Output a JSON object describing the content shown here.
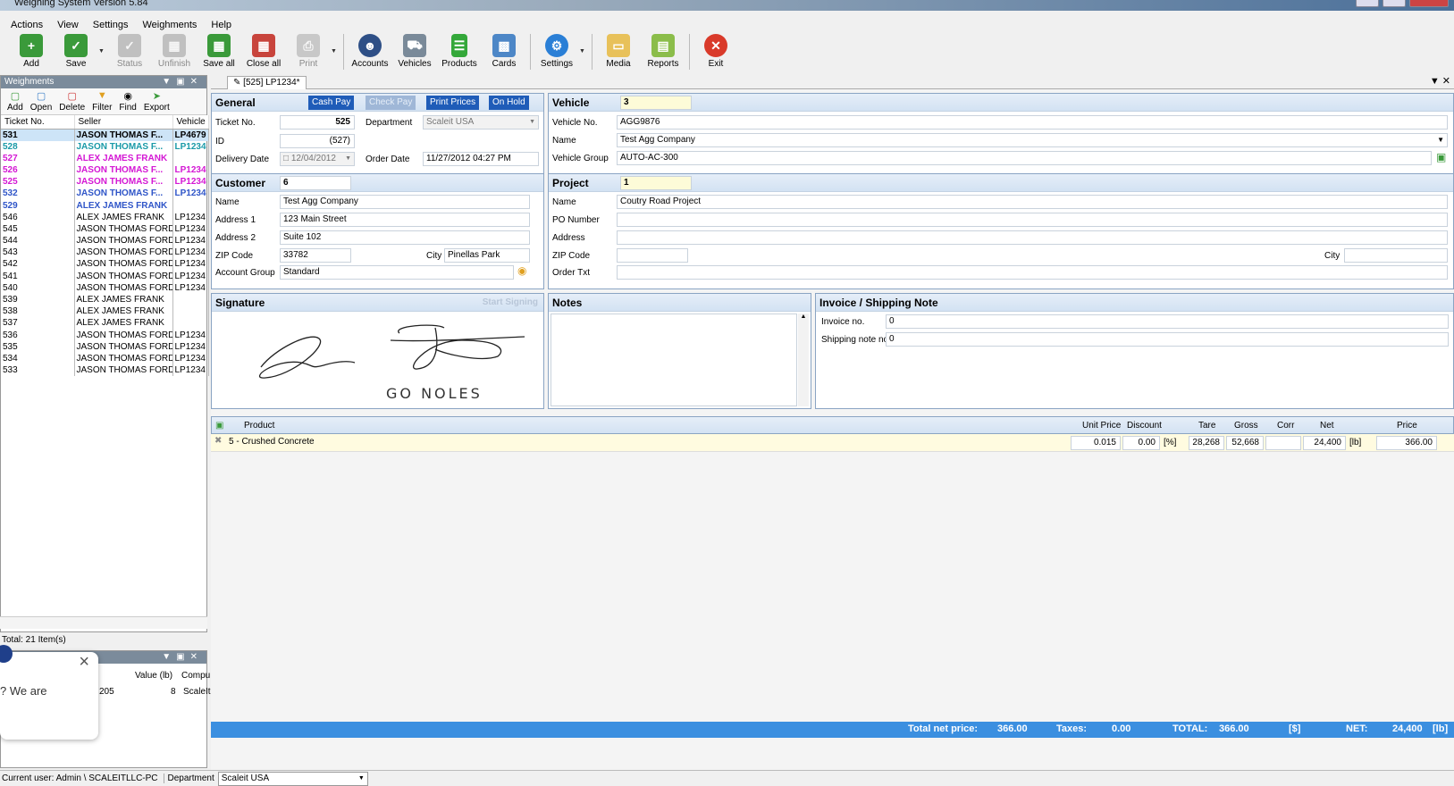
{
  "window": {
    "title": "Weighing System Version 5.84"
  },
  "menu": [
    "Actions",
    "View",
    "Settings",
    "Weighments",
    "Help"
  ],
  "toolbar": [
    {
      "label": "Add",
      "icon": "add-grid-icon",
      "enabled": true
    },
    {
      "label": "Save",
      "icon": "save-grid-icon",
      "enabled": true
    },
    {
      "label": "Status",
      "icon": "status-check-icon",
      "enabled": false
    },
    {
      "label": "Unfinish",
      "icon": "unfinish-grid-icon",
      "enabled": false
    },
    {
      "label": "Save all",
      "icon": "save-all-icon",
      "enabled": true
    },
    {
      "label": "Close all",
      "icon": "close-all-icon",
      "enabled": true
    },
    {
      "label": "Print",
      "icon": "printer-icon",
      "enabled": false
    },
    {
      "label": "Accounts",
      "icon": "accounts-icon",
      "enabled": true
    },
    {
      "label": "Vehicles",
      "icon": "vehicles-icon",
      "enabled": true
    },
    {
      "label": "Products",
      "icon": "products-icon",
      "enabled": true
    },
    {
      "label": "Cards",
      "icon": "cards-icon",
      "enabled": true
    },
    {
      "label": "Settings",
      "icon": "settings-gear-icon",
      "enabled": true
    },
    {
      "label": "Media",
      "icon": "media-folder-icon",
      "enabled": true
    },
    {
      "label": "Reports",
      "icon": "reports-icon",
      "enabled": true
    },
    {
      "label": "Exit",
      "icon": "exit-icon",
      "enabled": true
    }
  ],
  "weighments": {
    "title": "Weighments",
    "tools": [
      "Add",
      "Open",
      "Delete",
      "Filter",
      "Find",
      "Export"
    ],
    "columns": [
      "Ticket No.",
      "Seller",
      "Vehicle"
    ],
    "rows": [
      {
        "ticket": "531",
        "seller": "JASON THOMAS F...",
        "vehicle": "LP4679",
        "style": "sel"
      },
      {
        "ticket": "528",
        "seller": "JASON THOMAS F...",
        "vehicle": "LP1234",
        "style": "teal"
      },
      {
        "ticket": "527",
        "seller": "ALEX JAMES FRANK",
        "vehicle": "",
        "style": "mag"
      },
      {
        "ticket": "526",
        "seller": "JASON THOMAS F...",
        "vehicle": "LP1234",
        "style": "mag"
      },
      {
        "ticket": "525",
        "seller": "JASON THOMAS F...",
        "vehicle": "LP1234",
        "style": "mag"
      },
      {
        "ticket": "532",
        "seller": "JASON THOMAS F...",
        "vehicle": "LP1234",
        "style": "blue"
      },
      {
        "ticket": "529",
        "seller": "ALEX JAMES FRANK",
        "vehicle": "",
        "style": "blue"
      },
      {
        "ticket": "546",
        "seller": "ALEX JAMES FRANK",
        "vehicle": "LP1234",
        "style": ""
      },
      {
        "ticket": "545",
        "seller": "JASON THOMAS FORD",
        "vehicle": "LP1234",
        "style": ""
      },
      {
        "ticket": "544",
        "seller": "JASON THOMAS FORD",
        "vehicle": "LP1234",
        "style": ""
      },
      {
        "ticket": "543",
        "seller": "JASON THOMAS FORD",
        "vehicle": "LP1234",
        "style": ""
      },
      {
        "ticket": "542",
        "seller": "JASON THOMAS FORD",
        "vehicle": "LP1234",
        "style": ""
      },
      {
        "ticket": "541",
        "seller": "JASON THOMAS FORD",
        "vehicle": "LP1234",
        "style": ""
      },
      {
        "ticket": "540",
        "seller": "JASON THOMAS FORD",
        "vehicle": "LP1234",
        "style": ""
      },
      {
        "ticket": "539",
        "seller": "ALEX JAMES FRANK",
        "vehicle": "",
        "style": ""
      },
      {
        "ticket": "538",
        "seller": "ALEX JAMES FRANK",
        "vehicle": "",
        "style": ""
      },
      {
        "ticket": "537",
        "seller": "ALEX JAMES FRANK",
        "vehicle": "",
        "style": ""
      },
      {
        "ticket": "536",
        "seller": "JASON THOMAS FORD",
        "vehicle": "LP1234",
        "style": ""
      },
      {
        "ticket": "535",
        "seller": "JASON THOMAS FORD",
        "vehicle": "LP1234",
        "style": ""
      },
      {
        "ticket": "534",
        "seller": "JASON THOMAS FORD",
        "vehicle": "LP1234",
        "style": ""
      },
      {
        "ticket": "533",
        "seller": "JASON THOMAS FORD",
        "vehicle": "LP1234",
        "style": ""
      }
    ],
    "total": "Total: 21 Item(s)"
  },
  "lower_panel": {
    "columns": [
      "Value (lb)",
      "Compu"
    ],
    "row": {
      "c1": "205",
      "value": "8",
      "comp": "ScaleIt"
    },
    "toast_text": "? We are"
  },
  "tab": {
    "label": "[525] LP1234*"
  },
  "general": {
    "title": "General",
    "buttons": [
      {
        "label": "Cash Pay",
        "enabled": true
      },
      {
        "label": "Check Pay",
        "enabled": false
      },
      {
        "label": "Print Prices",
        "enabled": true
      },
      {
        "label": "On Hold",
        "enabled": true
      }
    ],
    "ticket_label": "Ticket No.",
    "ticket": "525",
    "department_label": "Department",
    "department": "Scaleit USA",
    "id_label": "ID",
    "id": "(527)",
    "delivery_label": "Delivery Date",
    "delivery": "12/04/2012",
    "order_label": "Order Date",
    "order": "11/27/2012 04:27 PM"
  },
  "vehicle": {
    "title": "Vehicle",
    "code": "3",
    "no_label": "Vehicle No.",
    "no": "AGG9876",
    "name_label": "Name",
    "name": "Test Agg Company",
    "group_label": "Vehicle Group",
    "group": "AUTO-AC-300"
  },
  "customer": {
    "title": "Customer",
    "code": "6",
    "name_label": "Name",
    "name": "Test Agg Company",
    "addr1_label": "Address 1",
    "addr1": "123 Main Street",
    "addr2_label": "Address 2",
    "addr2": "Suite 102",
    "zip_label": "ZIP Code",
    "zip": "33782",
    "city_label": "City",
    "city": "Pinellas Park",
    "group_label": "Account Group",
    "group": "Standard"
  },
  "project": {
    "title": "Project",
    "code": "1",
    "name_label": "Name",
    "name": "Coutry Road Project",
    "po_label": "PO Number",
    "po": "",
    "address_label": "Address",
    "address": "",
    "zip_label": "ZIP Code",
    "zip": "",
    "city_label": "City",
    "city": "",
    "order_label": "Order Txt",
    "order": ""
  },
  "signature": {
    "title": "Signature",
    "action": "Start Signing"
  },
  "notes": {
    "title": "Notes"
  },
  "invoice": {
    "title": "Invoice / Shipping Note",
    "invoice_label": "Invoice no.",
    "invoice": "0",
    "shipping_label": "Shipping note no.",
    "shipping": "0"
  },
  "products": {
    "columns": {
      "product": "Product",
      "unit_price": "Unit Price",
      "discount": "Discount",
      "tare": "Tare",
      "gross": "Gross",
      "corr": "Corr",
      "net": "Net",
      "price": "Price"
    },
    "row": {
      "product": "5 - Crushed Concrete",
      "unit_price": "0.015",
      "discount": "0.00",
      "discount_unit": "[%]",
      "tare": "28,268",
      "gross": "52,668",
      "corr": "",
      "net": "24,400",
      "net_unit": "[lb]",
      "price": "366.00"
    }
  },
  "totals": {
    "net_price_label": "Total net price:",
    "net_price": "366.00",
    "taxes_label": "Taxes:",
    "taxes": "0.00",
    "total_label": "TOTAL:",
    "total": "366.00",
    "currency": "[$]",
    "net_label": "NET:",
    "net": "24,400",
    "net_unit": "[lb]"
  },
  "status": {
    "user": "Current user: Admin \\ SCALEITLLC-PC",
    "dept_label": "Department",
    "dept": "Scaleit USA"
  },
  "colors": {
    "accent": "#1f5cb8",
    "bottom_bar": "#3b8fe0",
    "section_border": "#8aa4c3"
  }
}
